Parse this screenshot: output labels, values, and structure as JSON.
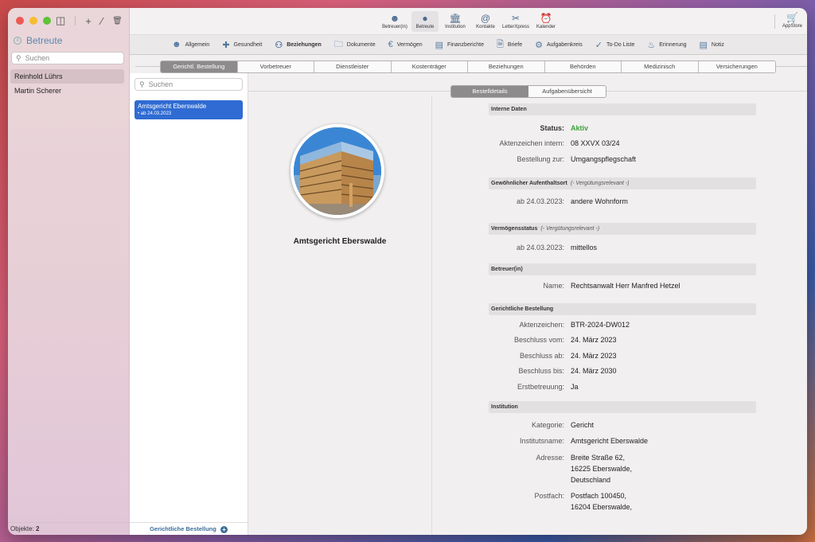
{
  "sidebar": {
    "title": "Betreute",
    "search_placeholder": "Suchen",
    "items": [
      {
        "label": "Reinhold Lührs",
        "selected": true
      },
      {
        "label": "Martin Scherer",
        "selected": false
      }
    ],
    "footer_label": "Objekte:",
    "footer_count": "2"
  },
  "toolbar": {
    "buttons": [
      {
        "label": "Betreuer(in)",
        "icon": "people-outline-icon"
      },
      {
        "label": "Betreute",
        "icon": "person-icon",
        "active": true
      },
      {
        "label": "Institution",
        "icon": "building-icon"
      },
      {
        "label": "Kontakte",
        "icon": "at-icon"
      },
      {
        "label": "LetterXpress",
        "icon": "scissors-icon"
      },
      {
        "label": "Kalender",
        "icon": "alarm-icon"
      }
    ],
    "appstore_label": "AppStore"
  },
  "nav": {
    "items": [
      {
        "label": "Allgemein",
        "icon": "person-icon"
      },
      {
        "label": "Gesundheit",
        "icon": "medkit-icon"
      },
      {
        "label": "Beziehungen",
        "icon": "relationships-icon",
        "active": true
      },
      {
        "label": "Dokumente",
        "icon": "folder-icon"
      },
      {
        "label": "Vermögen",
        "icon": "euro-icon"
      },
      {
        "label": "Finanzberichte",
        "icon": "chart-icon"
      },
      {
        "label": "Briefe",
        "icon": "document-icon"
      },
      {
        "label": "Aufgabenkreis",
        "icon": "gear-person-icon"
      },
      {
        "label": "To-Do Liste",
        "icon": "checkmark-icon"
      },
      {
        "label": "Erinnerung",
        "icon": "bell-icon"
      },
      {
        "label": "Notiz",
        "icon": "note-icon"
      }
    ]
  },
  "tabs": [
    {
      "label": "Gerichtl. Bestellung",
      "active": true
    },
    {
      "label": "Vorbetreuer"
    },
    {
      "label": "Dienstleister"
    },
    {
      "label": "Kostenträger"
    },
    {
      "label": "Beziehungen"
    },
    {
      "label": "Behörden"
    },
    {
      "label": "Medizinisch"
    },
    {
      "label": "Versicherungen"
    }
  ],
  "list": {
    "search_placeholder": "Suchen",
    "items": [
      {
        "title": "Amtsgericht Eberswalde",
        "subtitle": "• ab 24.03.2023"
      }
    ],
    "footer_label": "Gerichtliche Bestellung"
  },
  "segments": [
    {
      "label": "Bestelldetails",
      "active": true
    },
    {
      "label": "Aufgabenübersicht"
    }
  ],
  "card": {
    "name": "Amtsgericht Eberswalde"
  },
  "details": {
    "interne": {
      "title": "Interne Daten",
      "status_label": "Status:",
      "status_value": "Aktiv",
      "az_label": "Aktenzeichen intern:",
      "az_value": "08 XXVX 03/24",
      "bestellung_label": "Bestellung zur:",
      "bestellung_value": "Umgangspflegschaft"
    },
    "aufenthalt": {
      "title": "Gewöhnlicher Aufenthaltsort",
      "note": "(- Vergütungsrelevant -)",
      "label": "ab 24.03.2023:",
      "value": "andere Wohnform"
    },
    "vermoegen": {
      "title": "Vermögensstatus",
      "note": "(- Vergütungsrelevant -)",
      "label": "ab 24.03.2023:",
      "value": "mittellos"
    },
    "betreuer": {
      "title": "Betreuer(in)",
      "label": "Name:",
      "value": "Rechtsanwalt Herr Manfred Hetzel"
    },
    "gericht": {
      "title": "Gerichtliche Bestellung",
      "az_label": "Aktenzeichen:",
      "az_value": "BTR-2024-DW012",
      "vom_label": "Beschluss vom:",
      "vom_value": "24. März 2023",
      "ab_label": "Beschluss ab:",
      "ab_value": "24. März 2023",
      "bis_label": "Beschluss bis:",
      "bis_value": "24. März 2030",
      "erst_label": "Erstbetreuung:",
      "erst_value": "Ja"
    },
    "institution": {
      "title": "Institution",
      "kat_label": "Kategorie:",
      "kat_value": "Gericht",
      "name_label": "Institutsname:",
      "name_value": "Amtsgericht Eberswalde",
      "adr_label": "Adresse:",
      "adr_line1": "Breite Straße 62,",
      "adr_line2": "16225 Eberswalde,",
      "adr_line3": "Deutschland",
      "post_label": "Postfach:",
      "post_line1": "Postfach 100450,",
      "post_line2": "16204 Eberswalde,"
    }
  }
}
